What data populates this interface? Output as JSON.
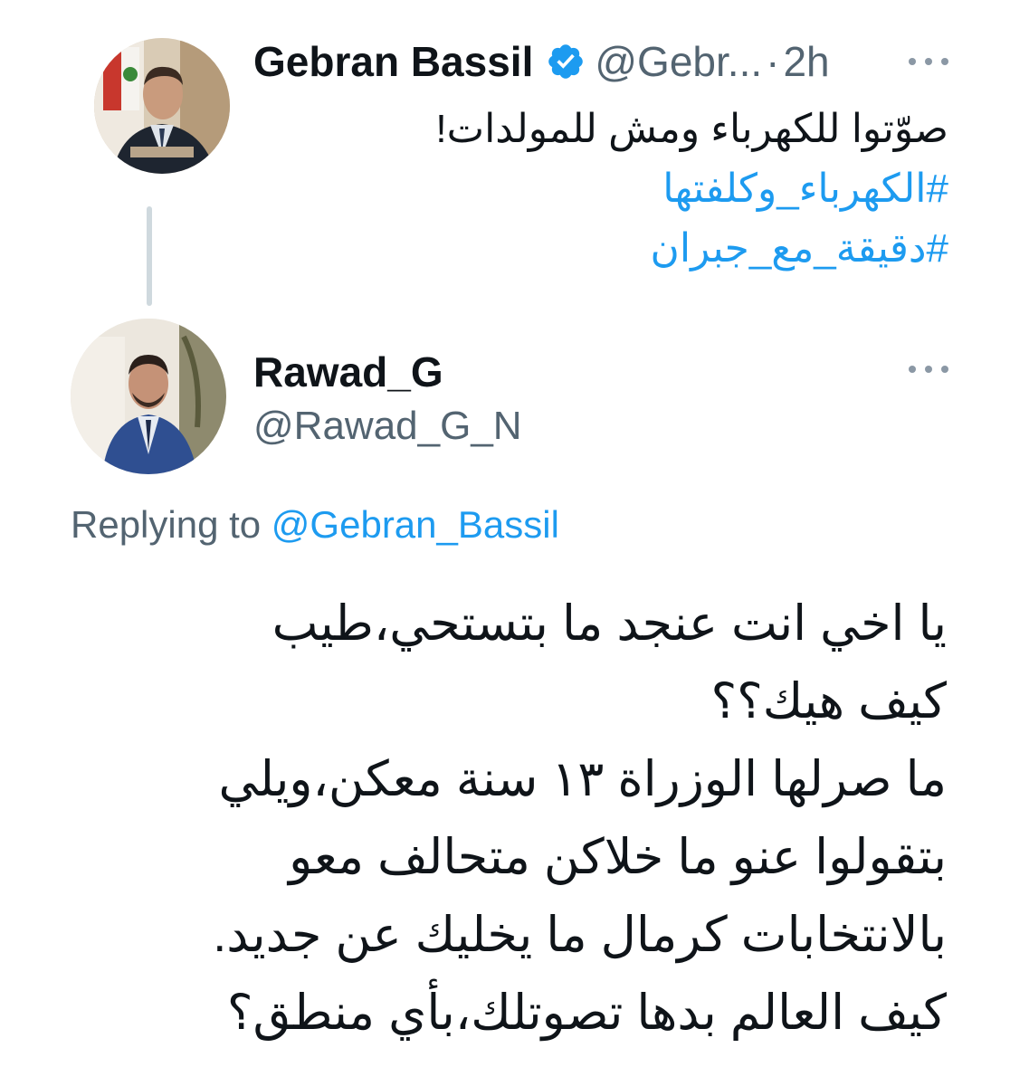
{
  "tweet": {
    "author_name": "Gebran Bassil",
    "handle_truncated": "@Gebr...",
    "separator": "·",
    "time": "2h",
    "text": "صوّتوا للكهرباء ومش للمولدات!",
    "hashtags": [
      "#الكهرباء_وكلفتها",
      "#دقيقة_مع_جبران"
    ],
    "verified_color": "#1d9bf0"
  },
  "reply": {
    "author_name": "Rawad_G",
    "handle": "@Rawad_G_N",
    "replying_prefix": "Replying to",
    "replying_mention": "@Gebran_Bassil",
    "lines": [
      "يا اخي انت عنجد ما بتستحي،طيب",
      "كيف هيك؟؟",
      "ما صرلها الوزراة ١٣ سنة معكن،ويلي",
      "بتقولوا عنو ما خلاكن متحالف معو",
      "بالانتخابات كرمال ما يخليك عن جديد.",
      "كيف العالم بدها تصوتلك،بأي منطق؟"
    ]
  },
  "colors": {
    "link": "#1d9bf0",
    "secondary_text": "#536471",
    "primary_text": "#0f1419",
    "thread_line": "#cfd9de"
  },
  "icons": {
    "verified": "verified-badge-icon",
    "more": "more-horizontal-icon"
  }
}
